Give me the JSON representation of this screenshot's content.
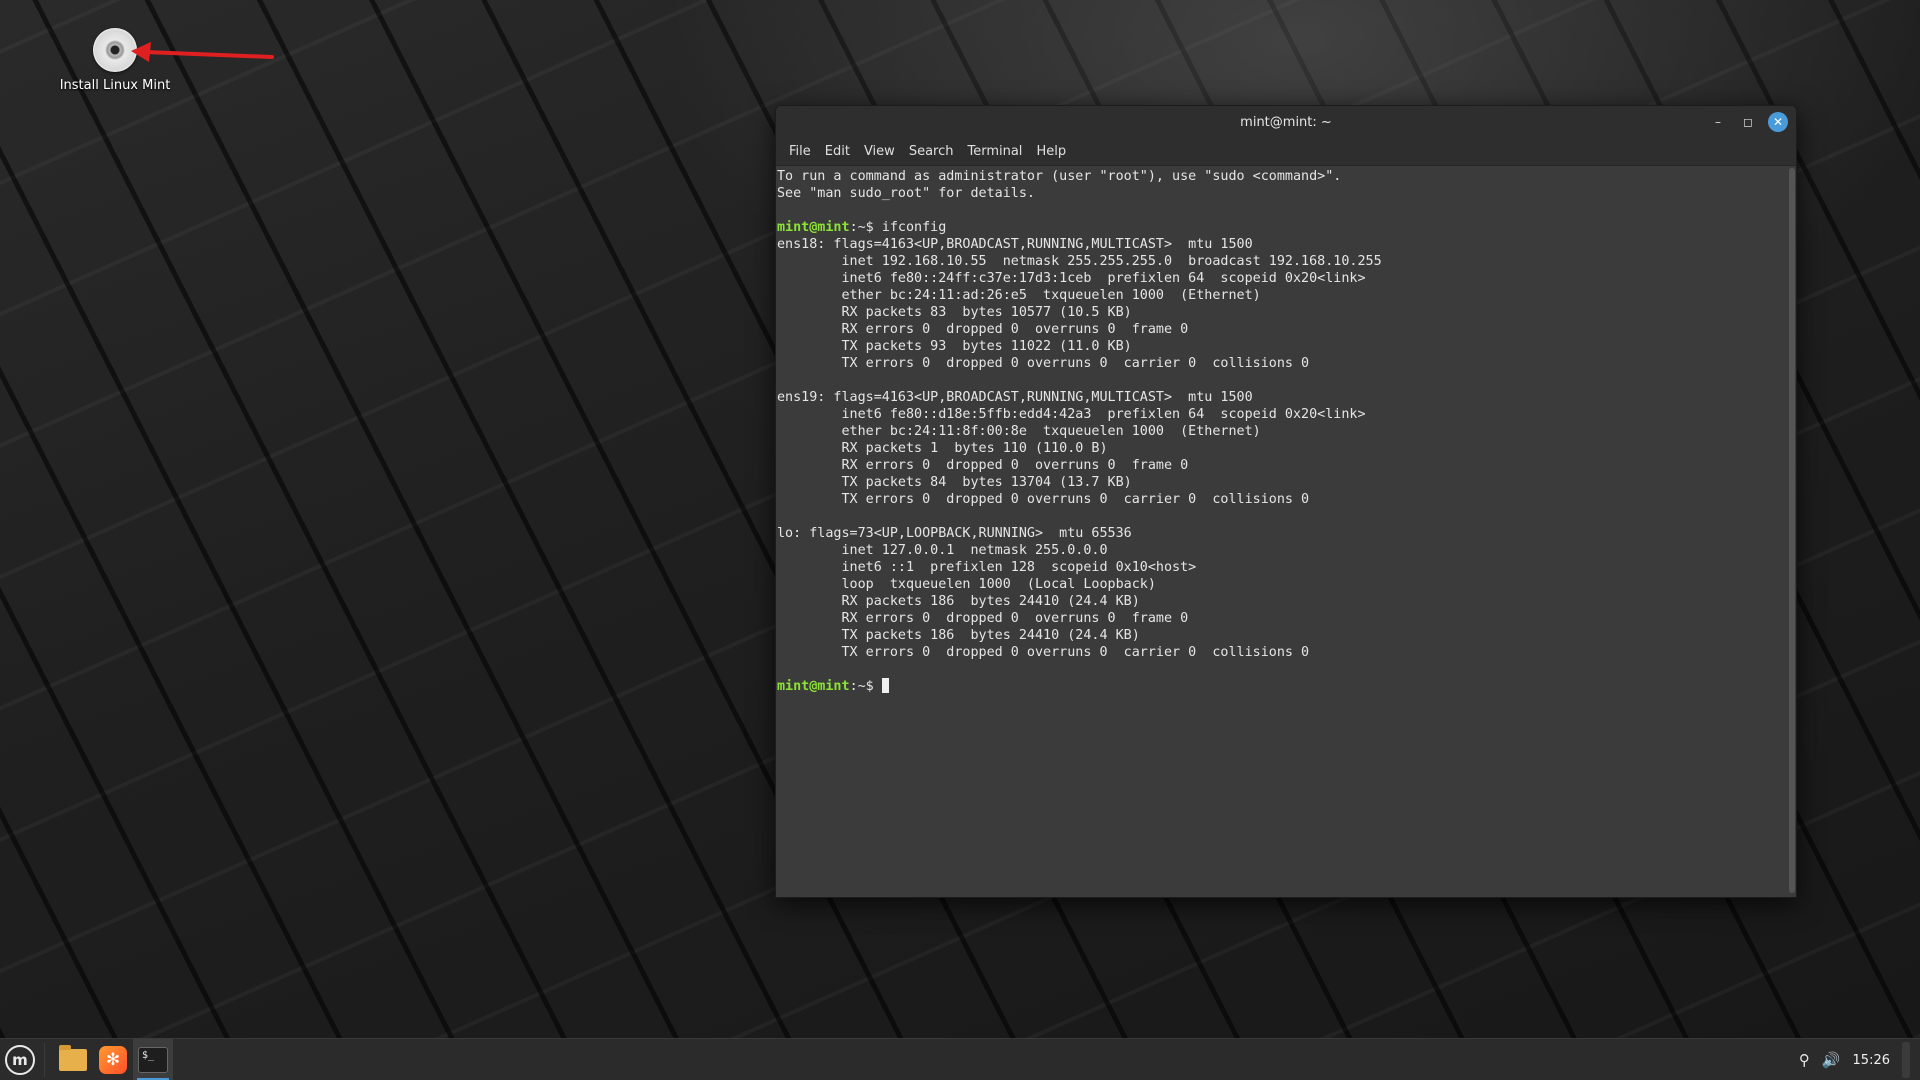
{
  "desktop": {
    "icons": [
      {
        "label": "Install Linux Mint",
        "icon": "disc-icon"
      }
    ],
    "annotation": {
      "type": "arrow",
      "color": "#e02020"
    }
  },
  "terminal": {
    "title": "mint@mint: ~",
    "menu": [
      "File",
      "Edit",
      "View",
      "Search",
      "Terminal",
      "Help"
    ],
    "window_controls": [
      "minimize",
      "maximize",
      "close"
    ],
    "prompt_user": "mint@mint",
    "prompt_suffix": ":~$ ",
    "lines": [
      {
        "text": "To run a command as administrator (user \"root\"), use \"sudo <command>\"."
      },
      {
        "text": "See \"man sudo_root\" for details."
      },
      {
        "text": ""
      },
      {
        "prompt": true,
        "text": "ifconfig"
      },
      {
        "text": "ens18: flags=4163<UP,BROADCAST,RUNNING,MULTICAST>  mtu 1500"
      },
      {
        "text": "        inet 192.168.10.55  netmask 255.255.255.0  broadcast 192.168.10.255"
      },
      {
        "text": "        inet6 fe80::24ff:c37e:17d3:1ceb  prefixlen 64  scopeid 0x20<link>"
      },
      {
        "text": "        ether bc:24:11:ad:26:e5  txqueuelen 1000  (Ethernet)"
      },
      {
        "text": "        RX packets 83  bytes 10577 (10.5 KB)"
      },
      {
        "text": "        RX errors 0  dropped 0  overruns 0  frame 0"
      },
      {
        "text": "        TX packets 93  bytes 11022 (11.0 KB)"
      },
      {
        "text": "        TX errors 0  dropped 0 overruns 0  carrier 0  collisions 0"
      },
      {
        "text": ""
      },
      {
        "text": "ens19: flags=4163<UP,BROADCAST,RUNNING,MULTICAST>  mtu 1500"
      },
      {
        "text": "        inet6 fe80::d18e:5ffb:edd4:42a3  prefixlen 64  scopeid 0x20<link>"
      },
      {
        "text": "        ether bc:24:11:8f:00:8e  txqueuelen 1000  (Ethernet)"
      },
      {
        "text": "        RX packets 1  bytes 110 (110.0 B)"
      },
      {
        "text": "        RX errors 0  dropped 0  overruns 0  frame 0"
      },
      {
        "text": "        TX packets 84  bytes 13704 (13.7 KB)"
      },
      {
        "text": "        TX errors 0  dropped 0 overruns 0  carrier 0  collisions 0"
      },
      {
        "text": ""
      },
      {
        "text": "lo: flags=73<UP,LOOPBACK,RUNNING>  mtu 65536"
      },
      {
        "text": "        inet 127.0.0.1  netmask 255.0.0.0"
      },
      {
        "text": "        inet6 ::1  prefixlen 128  scopeid 0x10<host>"
      },
      {
        "text": "        loop  txqueuelen 1000  (Local Loopback)"
      },
      {
        "text": "        RX packets 186  bytes 24410 (24.4 KB)"
      },
      {
        "text": "        RX errors 0  dropped 0  overruns 0  frame 0"
      },
      {
        "text": "        TX packets 186  bytes 24410 (24.4 KB)"
      },
      {
        "text": "        TX errors 0  dropped 0 overruns 0  carrier 0  collisions 0"
      },
      {
        "text": ""
      },
      {
        "prompt": true,
        "text": "",
        "cursor": true
      }
    ],
    "colors": {
      "background": "#3b3b3b",
      "prompt": "#8ae234",
      "text": "#e5e5e5"
    }
  },
  "taskbar": {
    "items": [
      {
        "name": "menu-button",
        "icon": "mint-logo-icon",
        "glyph": "m"
      },
      {
        "name": "files",
        "icon": "folder-icon"
      },
      {
        "name": "firefox",
        "icon": "firefox-icon"
      },
      {
        "name": "terminal",
        "icon": "terminal-icon",
        "glyph": "$_",
        "active": true
      }
    ],
    "tray": {
      "network_icon": "network-icon",
      "volume_icon": "volume-icon"
    },
    "clock": "15:26"
  }
}
